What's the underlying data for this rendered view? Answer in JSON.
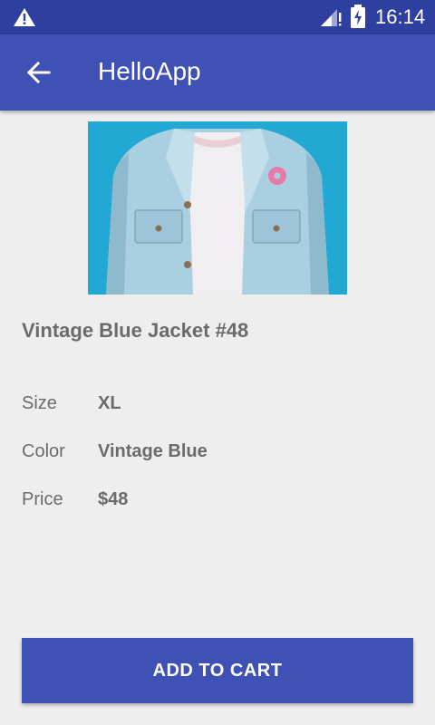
{
  "status_bar": {
    "time": "16:14",
    "icons": [
      "warning-icon",
      "signal-icon",
      "battery-charging-icon"
    ]
  },
  "app_bar": {
    "title": "HelloApp",
    "back_icon": "arrow-back-icon"
  },
  "product": {
    "image_icon": "jacket-photo",
    "title": "Vintage Blue Jacket #48",
    "specs": [
      {
        "label": "Size",
        "value": "XL"
      },
      {
        "label": "Color",
        "value": "Vintage Blue"
      },
      {
        "label": "Price",
        "value": "$48"
      }
    ]
  },
  "actions": {
    "add_to_cart_label": "ADD TO CART"
  },
  "colors": {
    "primary": "#3f51b5",
    "primary_dark": "#2f3f9f",
    "background": "#eeeeee",
    "text_secondary": "#6b6b6b"
  }
}
